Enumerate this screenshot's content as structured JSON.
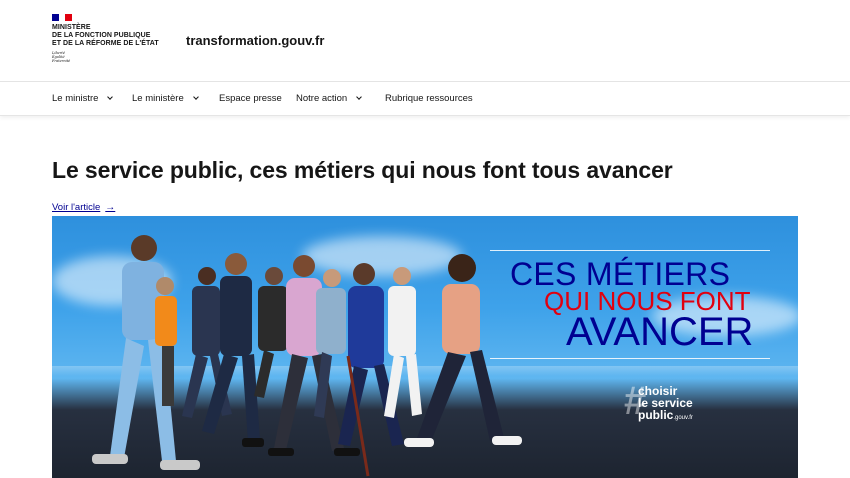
{
  "header": {
    "flag_colors": [
      "#000091",
      "#ffffff",
      "#e1000f"
    ],
    "ministry_lines": [
      "Ministère",
      "de la Fonction Publique",
      "et de la Réforme de l'État"
    ],
    "motto_lines": [
      "Liberté",
      "Égalité",
      "Fraternité"
    ],
    "site_name": "transformation.gouv.fr"
  },
  "nav": {
    "items": [
      {
        "label": "Le ministre",
        "has_dropdown": true
      },
      {
        "label": "Le ministère",
        "has_dropdown": true
      },
      {
        "label": "Espace presse",
        "has_dropdown": false
      },
      {
        "label": "Notre action",
        "has_dropdown": true
      },
      {
        "label": "Rubrique ressources",
        "has_dropdown": false
      }
    ]
  },
  "main": {
    "title": "Le service public, ces métiers qui nous font tous avancer",
    "article_link": "Voir l'article",
    "arrow_icon": "→"
  },
  "banner": {
    "slogan_line1": "CES MÉTIERS",
    "slogan_line2": "QUI NOUS FONT",
    "slogan_line3": "AVANCER",
    "hashtag_symbol": "#",
    "hashtag_line1": "choisir",
    "hashtag_line2": "le service",
    "hashtag_line3": "public",
    "hashtag_suffix": ".gouv.fr",
    "colors": {
      "blue": "#000091",
      "red": "#e1000f",
      "sky": "#3ea2ea"
    }
  }
}
